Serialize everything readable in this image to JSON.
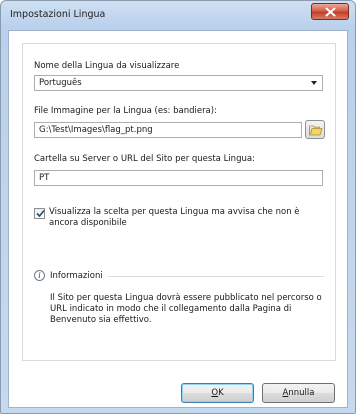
{
  "window": {
    "title": "Impostazioni Lingua"
  },
  "language": {
    "label": "Nome della Lingua da visualizzare",
    "selected": "Português"
  },
  "image": {
    "label": "File Immagine per la Lingua (es: bandiera):",
    "value": "G:\\Test\\Images\\flag_pt.png",
    "browse_icon": "folder-open-icon"
  },
  "site": {
    "label": "Cartella su Server o URL del Sito per questa Lingua:",
    "value": "PT"
  },
  "checkbox": {
    "checked": true,
    "label": "Visualizza la scelta per questa Lingua ma avvisa che non è ancora disponibile"
  },
  "info": {
    "title": "Informazioni",
    "text": "Il Sito per questa Lingua dovrà essere pubblicato nel percorso o URL indicato in modo che il collegamento dalla Pagina di Benvenuto sia effettivo."
  },
  "buttons": {
    "ok_first": "O",
    "ok_rest": "K",
    "cancel_first": "A",
    "cancel_rest": "nnulla"
  },
  "colors": {
    "titlebar": "#b9d1ec",
    "close_button": "#c23f27",
    "default_button_border": "#3c7fb1"
  }
}
